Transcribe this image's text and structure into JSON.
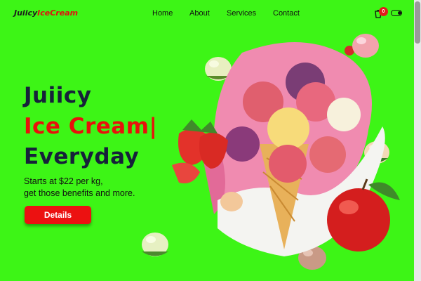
{
  "logo": {
    "part1": "Juiicy",
    "part2": "IceCream"
  },
  "nav": {
    "home": "Home",
    "about": "About",
    "services": "Services",
    "contact": "Contact"
  },
  "cart": {
    "count": "0"
  },
  "hero": {
    "line1": "Juiicy",
    "line2": "Ice Cream",
    "cursor": "|",
    "line3": "Everyday",
    "sub1": "Starts at $22 per kg,",
    "sub2": "get those benefits and more.",
    "button": "Details"
  },
  "colors": {
    "background": "#3df516",
    "accent": "#e8110b",
    "heading": "#16213a"
  }
}
